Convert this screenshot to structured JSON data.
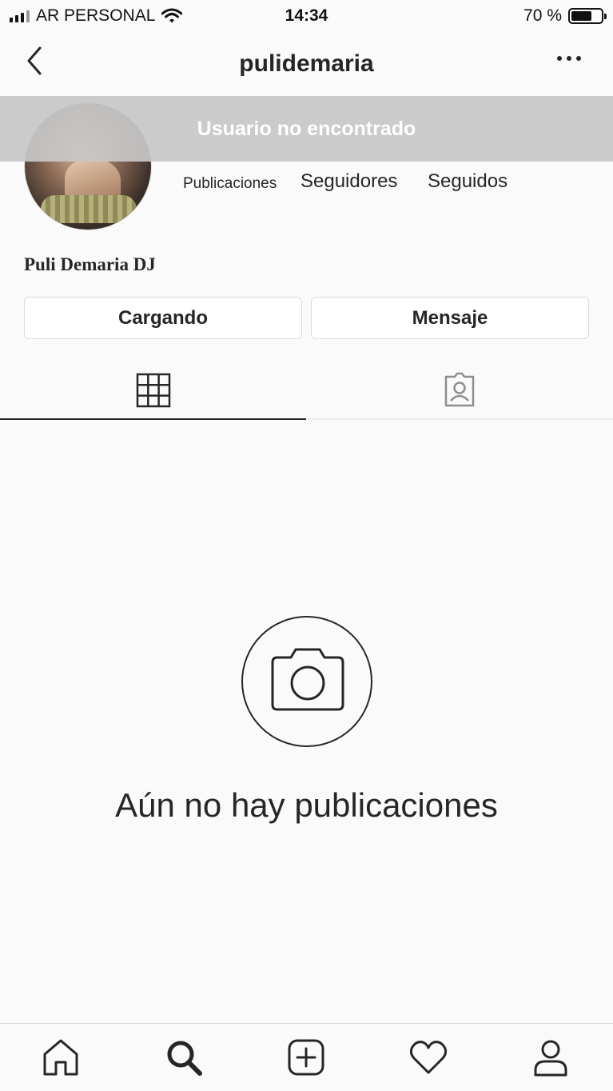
{
  "status_bar": {
    "carrier": "AR PERSONAL",
    "time": "14:34",
    "battery_text": "70 %",
    "battery_level": 0.7
  },
  "header": {
    "title": "pulidemaria",
    "back_icon": "chevron-left-icon",
    "more_icon": "more-dots-icon"
  },
  "toast": {
    "message": "Usuario no encontrado"
  },
  "profile": {
    "name": "Puli Demaria DJ",
    "stats": {
      "posts_label": "Publicaciones",
      "followers_label": "Seguidores",
      "following_label": "Seguidos"
    }
  },
  "actions": {
    "follow_label": "Cargando",
    "message_label": "Mensaje"
  },
  "tabs": [
    {
      "name": "grid-icon",
      "active": true
    },
    {
      "name": "tagged-icon",
      "active": false
    }
  ],
  "empty_state": {
    "icon": "camera-icon",
    "text": "Aún no hay publicaciones"
  },
  "bottom_nav": [
    {
      "name": "home-icon"
    },
    {
      "name": "search-icon",
      "active": true
    },
    {
      "name": "add-post-icon"
    },
    {
      "name": "heart-icon"
    },
    {
      "name": "profile-icon"
    }
  ],
  "colors": {
    "background": "#fafafa",
    "text": "#262626",
    "border": "#dbdbdb",
    "toast_bg": "#c7c7c7"
  }
}
